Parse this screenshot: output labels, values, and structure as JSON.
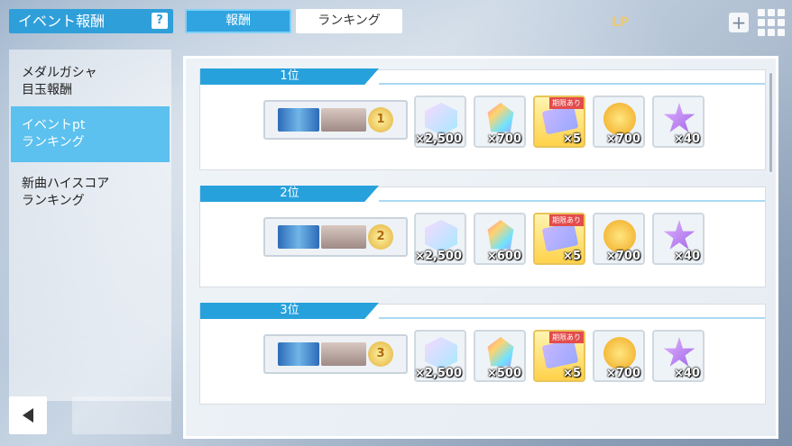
{
  "header": {
    "title": "イベント報酬",
    "help_label": "?",
    "tabs": [
      {
        "label": "報酬",
        "active": true
      },
      {
        "label": "ランキング",
        "active": false
      }
    ],
    "lp_label": "LP"
  },
  "sidebar": {
    "items": [
      {
        "label": "メダルガシャ\n目玉報酬",
        "active": false
      },
      {
        "label": "イベントpt\nランキング",
        "active": true
      },
      {
        "label": "新曲ハイスコア\nランキング",
        "active": false
      }
    ],
    "back_label": "◀"
  },
  "ranks": [
    {
      "label": "1位",
      "badge": "1",
      "rewards": [
        {
          "icon": "silver-crystal-icon",
          "qty": "×2,500"
        },
        {
          "icon": "rainbow-crystal-icon",
          "qty": "×700"
        },
        {
          "icon": "gacha-ticket-icon",
          "qty": "×5",
          "tag": "期限あり"
        },
        {
          "icon": "gold-medal-icon",
          "qty": "×700"
        },
        {
          "icon": "purple-star-icon",
          "qty": "×40"
        }
      ]
    },
    {
      "label": "2位",
      "badge": "2",
      "rewards": [
        {
          "icon": "silver-crystal-icon",
          "qty": "×2,500"
        },
        {
          "icon": "rainbow-crystal-icon",
          "qty": "×600"
        },
        {
          "icon": "gacha-ticket-icon",
          "qty": "×5",
          "tag": "期限あり"
        },
        {
          "icon": "gold-medal-icon",
          "qty": "×700"
        },
        {
          "icon": "purple-star-icon",
          "qty": "×40"
        }
      ]
    },
    {
      "label": "3位",
      "badge": "3",
      "rewards": [
        {
          "icon": "silver-crystal-icon",
          "qty": "×2,500"
        },
        {
          "icon": "rainbow-crystal-icon",
          "qty": "×500"
        },
        {
          "icon": "gacha-ticket-icon",
          "qty": "×5",
          "tag": "期限あり"
        },
        {
          "icon": "gold-medal-icon",
          "qty": "×700"
        },
        {
          "icon": "purple-star-icon",
          "qty": "×40"
        }
      ]
    }
  ],
  "colors": {
    "accent": "#2f9fd9",
    "ribbon": "#27a1dc",
    "sidebar_active": "#5cc1ee"
  }
}
